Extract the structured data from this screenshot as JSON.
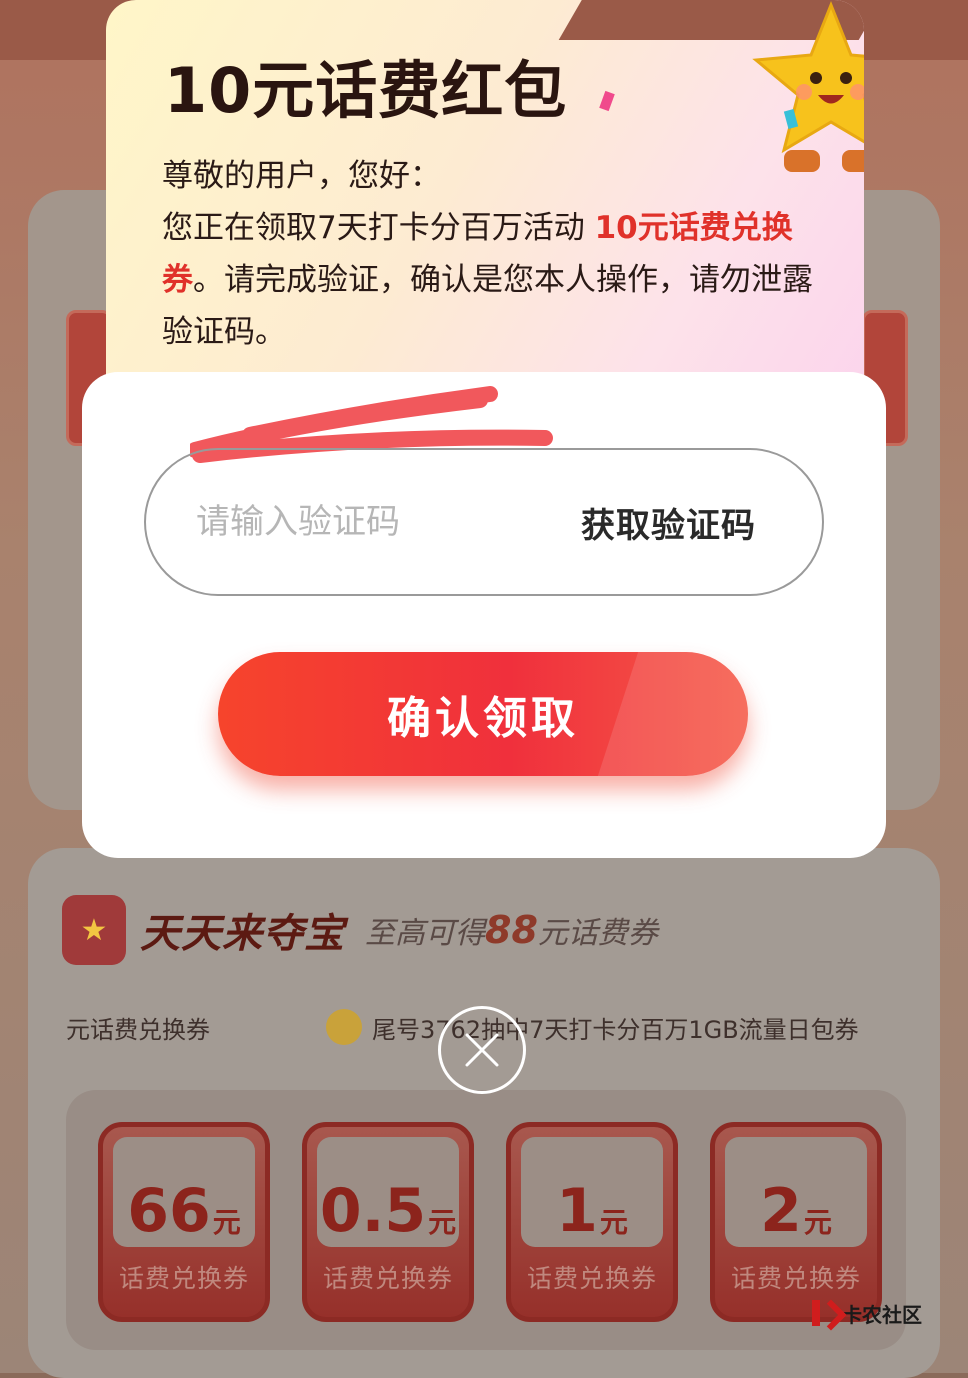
{
  "modal": {
    "title": "10元话费红包",
    "greeting": "尊敬的用户，您好：",
    "body_prefix": "您正在领取7天打卡分百万活动 ",
    "body_highlight": "10元话费兑换券",
    "body_suffix": "。请完成验证，确认是您本人操作，请勿泄露验证码。",
    "code_placeholder": "请输入验证码",
    "get_code_label": "获取验证码",
    "confirm_label": "确认领取"
  },
  "background": {
    "section_title": "天天来夺宝",
    "section_sub_prefix": "至高可得",
    "section_sub_amount": "88",
    "section_sub_suffix": "元话费券",
    "ticker_left": "元话费兑换券",
    "ticker_right": "尾号3762抽中7天打卡分百万1GB流量日包券",
    "prizes": [
      {
        "amount": "66",
        "unit": "元",
        "label": "话费兑换券"
      },
      {
        "amount": "0.5",
        "unit": "元",
        "label": "话费兑换券"
      },
      {
        "amount": "1",
        "unit": "元",
        "label": "话费兑换券"
      },
      {
        "amount": "2",
        "unit": "元",
        "label": "话费兑换券"
      }
    ],
    "watermark": "卡农社区"
  },
  "colors": {
    "accent_red": "#e0312a",
    "button_red": "#f6442c"
  }
}
